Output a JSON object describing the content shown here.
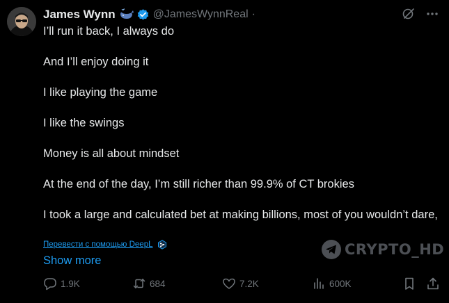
{
  "author": {
    "name": "James Wynn",
    "handle": "@JamesWynnReal",
    "separator": "·"
  },
  "icons": {
    "badge": "whale-icon",
    "verified": "verified-badge-icon",
    "grok": "grok-icon",
    "more": "more-icon"
  },
  "tweet": {
    "lines": [
      "I’ll run it back, I always do",
      "And I’ll enjoy doing it",
      "I like playing the game",
      "I like the swings",
      "Money is all about mindset",
      "At the end of the day, I’m still richer than 99.9% of CT brokies",
      "I took a large and calculated bet at making billions, most of you wouldn’t dare,"
    ],
    "translate_label": "Перевести с помощью DeepL",
    "show_more": "Show more"
  },
  "watermark": {
    "text": "CRYPTO_HD"
  },
  "actions": {
    "replies": "1.9K",
    "retweets": "684",
    "likes": "7.2K",
    "views": "600K"
  },
  "colors": {
    "background": "#000000",
    "text": "#e7e9ea",
    "secondary": "#71767b",
    "link": "#1d9bf0",
    "verified": "#1d9bf0"
  }
}
